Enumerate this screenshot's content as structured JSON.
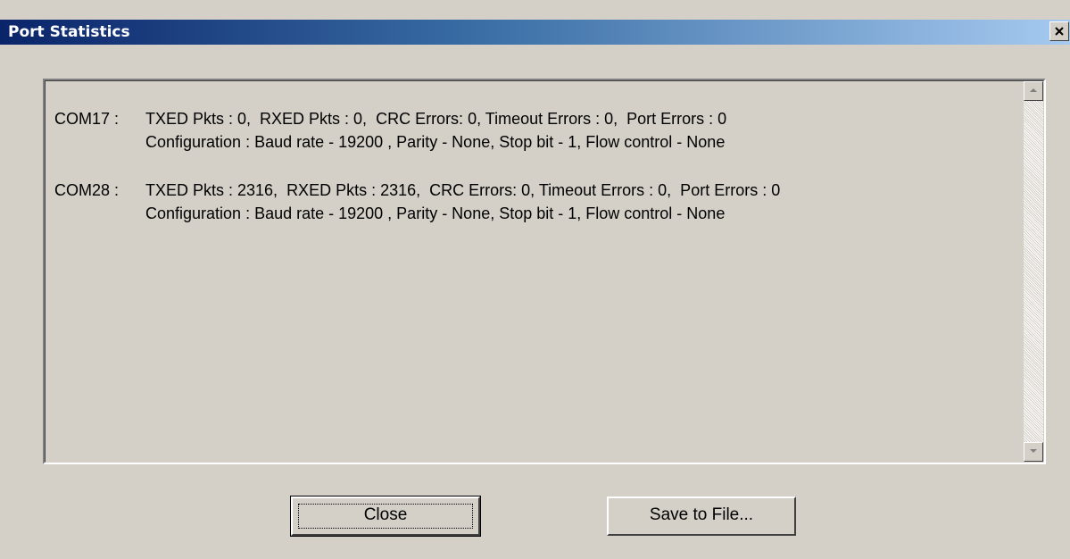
{
  "window": {
    "title": "Port Statistics",
    "close_icon": "close-x-icon"
  },
  "stats": [
    {
      "port": "COM17 :",
      "counters": "TXED Pkts : 0,  RXED Pkts : 0,  CRC Errors: 0, Timeout Errors : 0,  Port Errors : 0",
      "configuration": "Configuration : Baud rate - 19200 , Parity - None, Stop bit - 1, Flow control - None"
    },
    {
      "port": "COM28 :",
      "counters": "TXED Pkts : 2316,  RXED Pkts : 2316,  CRC Errors: 0, Timeout Errors : 0,  Port Errors : 0",
      "configuration": "Configuration : Baud rate - 19200 , Parity - None, Stop bit - 1, Flow control - None"
    }
  ],
  "buttons": {
    "close_label": "Close",
    "save_label": "Save to File..."
  },
  "colors": {
    "titlebar_start": "#0a246a",
    "titlebar_end": "#a6caf0",
    "face": "#d4d0c8"
  }
}
